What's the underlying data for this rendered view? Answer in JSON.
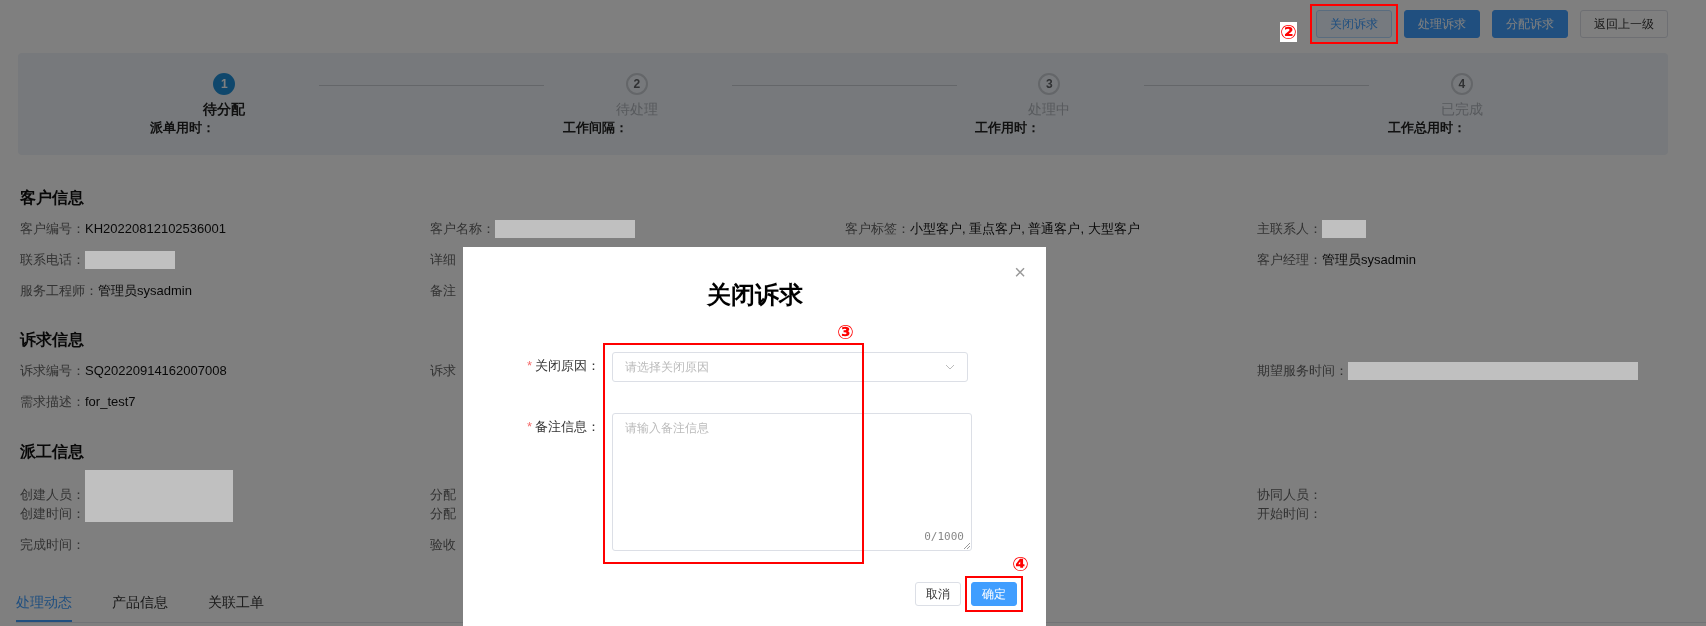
{
  "header_buttons": [
    {
      "label": "关闭诉求",
      "kind": "plain",
      "annotation": "②"
    },
    {
      "label": "处理诉求",
      "kind": "primary"
    },
    {
      "label": "分配诉求",
      "kind": "primary"
    },
    {
      "label": "返回上一级",
      "kind": "default"
    }
  ],
  "steps": [
    {
      "number": "1",
      "label": "待分配",
      "active": true
    },
    {
      "number": "2",
      "label": "待处理",
      "active": false
    },
    {
      "number": "3",
      "label": "处理中",
      "active": false
    },
    {
      "number": "4",
      "label": "已完成",
      "active": false
    }
  ],
  "step_times": [
    "派单用时：",
    "工作间隔：",
    "工作用时：",
    "工作总用时："
  ],
  "sections": [
    {
      "title": "客户信息",
      "rows": [
        [
          {
            "label": "客户编号：",
            "kind": "text",
            "value": "KH20220812102536001"
          },
          {
            "label": "客户名称：",
            "kind": "redacted"
          },
          {
            "label": "客户标签：",
            "kind": "text",
            "value": "小型客户, 重点客户, 普通客户, 大型客户"
          },
          {
            "label": "主联系人：",
            "kind": "redacted"
          }
        ],
        [
          {
            "label": "联系电话：",
            "kind": "redacted"
          },
          {
            "label": "详细",
            "kind": "empty"
          },
          null,
          {
            "label": "客户经理：",
            "kind": "text",
            "value": "管理员sysadmin"
          }
        ],
        [
          {
            "label": "服务工程师：",
            "kind": "text",
            "value": "管理员sysadmin"
          },
          {
            "label": "备注",
            "kind": "empty"
          },
          null,
          null
        ]
      ]
    },
    {
      "title": "诉求信息",
      "rows": [
        [
          {
            "label": "诉求编号：",
            "kind": "text",
            "value": "SQ20220914162007008"
          },
          {
            "label": "诉求",
            "kind": "empty"
          },
          null,
          {
            "label": "期望服务时间：",
            "kind": "redacted"
          }
        ],
        [
          {
            "label": "需求描述：",
            "kind": "text",
            "value": "for_test7"
          },
          null,
          null,
          null
        ]
      ]
    },
    {
      "title": "派工信息",
      "rows": [
        [
          {
            "label": "创建人员：",
            "kind": "redacted"
          },
          {
            "label": "分配",
            "kind": "empty"
          },
          null,
          {
            "label": "协同人员：",
            "kind": "empty"
          }
        ],
        [
          {
            "label": "创建时间：",
            "kind": "empty"
          },
          {
            "label": "分配",
            "kind": "empty"
          },
          null,
          {
            "label": "开始时间：",
            "kind": "empty"
          }
        ],
        [
          {
            "label": "完成时间：",
            "kind": "empty"
          },
          {
            "label": "验收",
            "kind": "empty"
          },
          null,
          null
        ]
      ]
    }
  ],
  "tabs": [
    {
      "label": "处理动态",
      "selected": true
    },
    {
      "label": "产品信息",
      "selected": false
    },
    {
      "label": "关联工单",
      "selected": false
    }
  ],
  "dialog": {
    "title": "关闭诉求",
    "close": "×",
    "annotation": "③",
    "fields": [
      {
        "label": "关闭原因：",
        "kind": "select",
        "required_mark": "*",
        "placeholder": "请选择关闭原因"
      },
      {
        "label": "备注信息：",
        "kind": "textarea",
        "required_mark": "*",
        "placeholder": "请输入备注信息",
        "counter": "0/1000"
      }
    ],
    "buttons": [
      {
        "label": "取消",
        "kind": "default"
      },
      {
        "label": "确定",
        "kind": "primary",
        "annotation": "④"
      }
    ]
  }
}
